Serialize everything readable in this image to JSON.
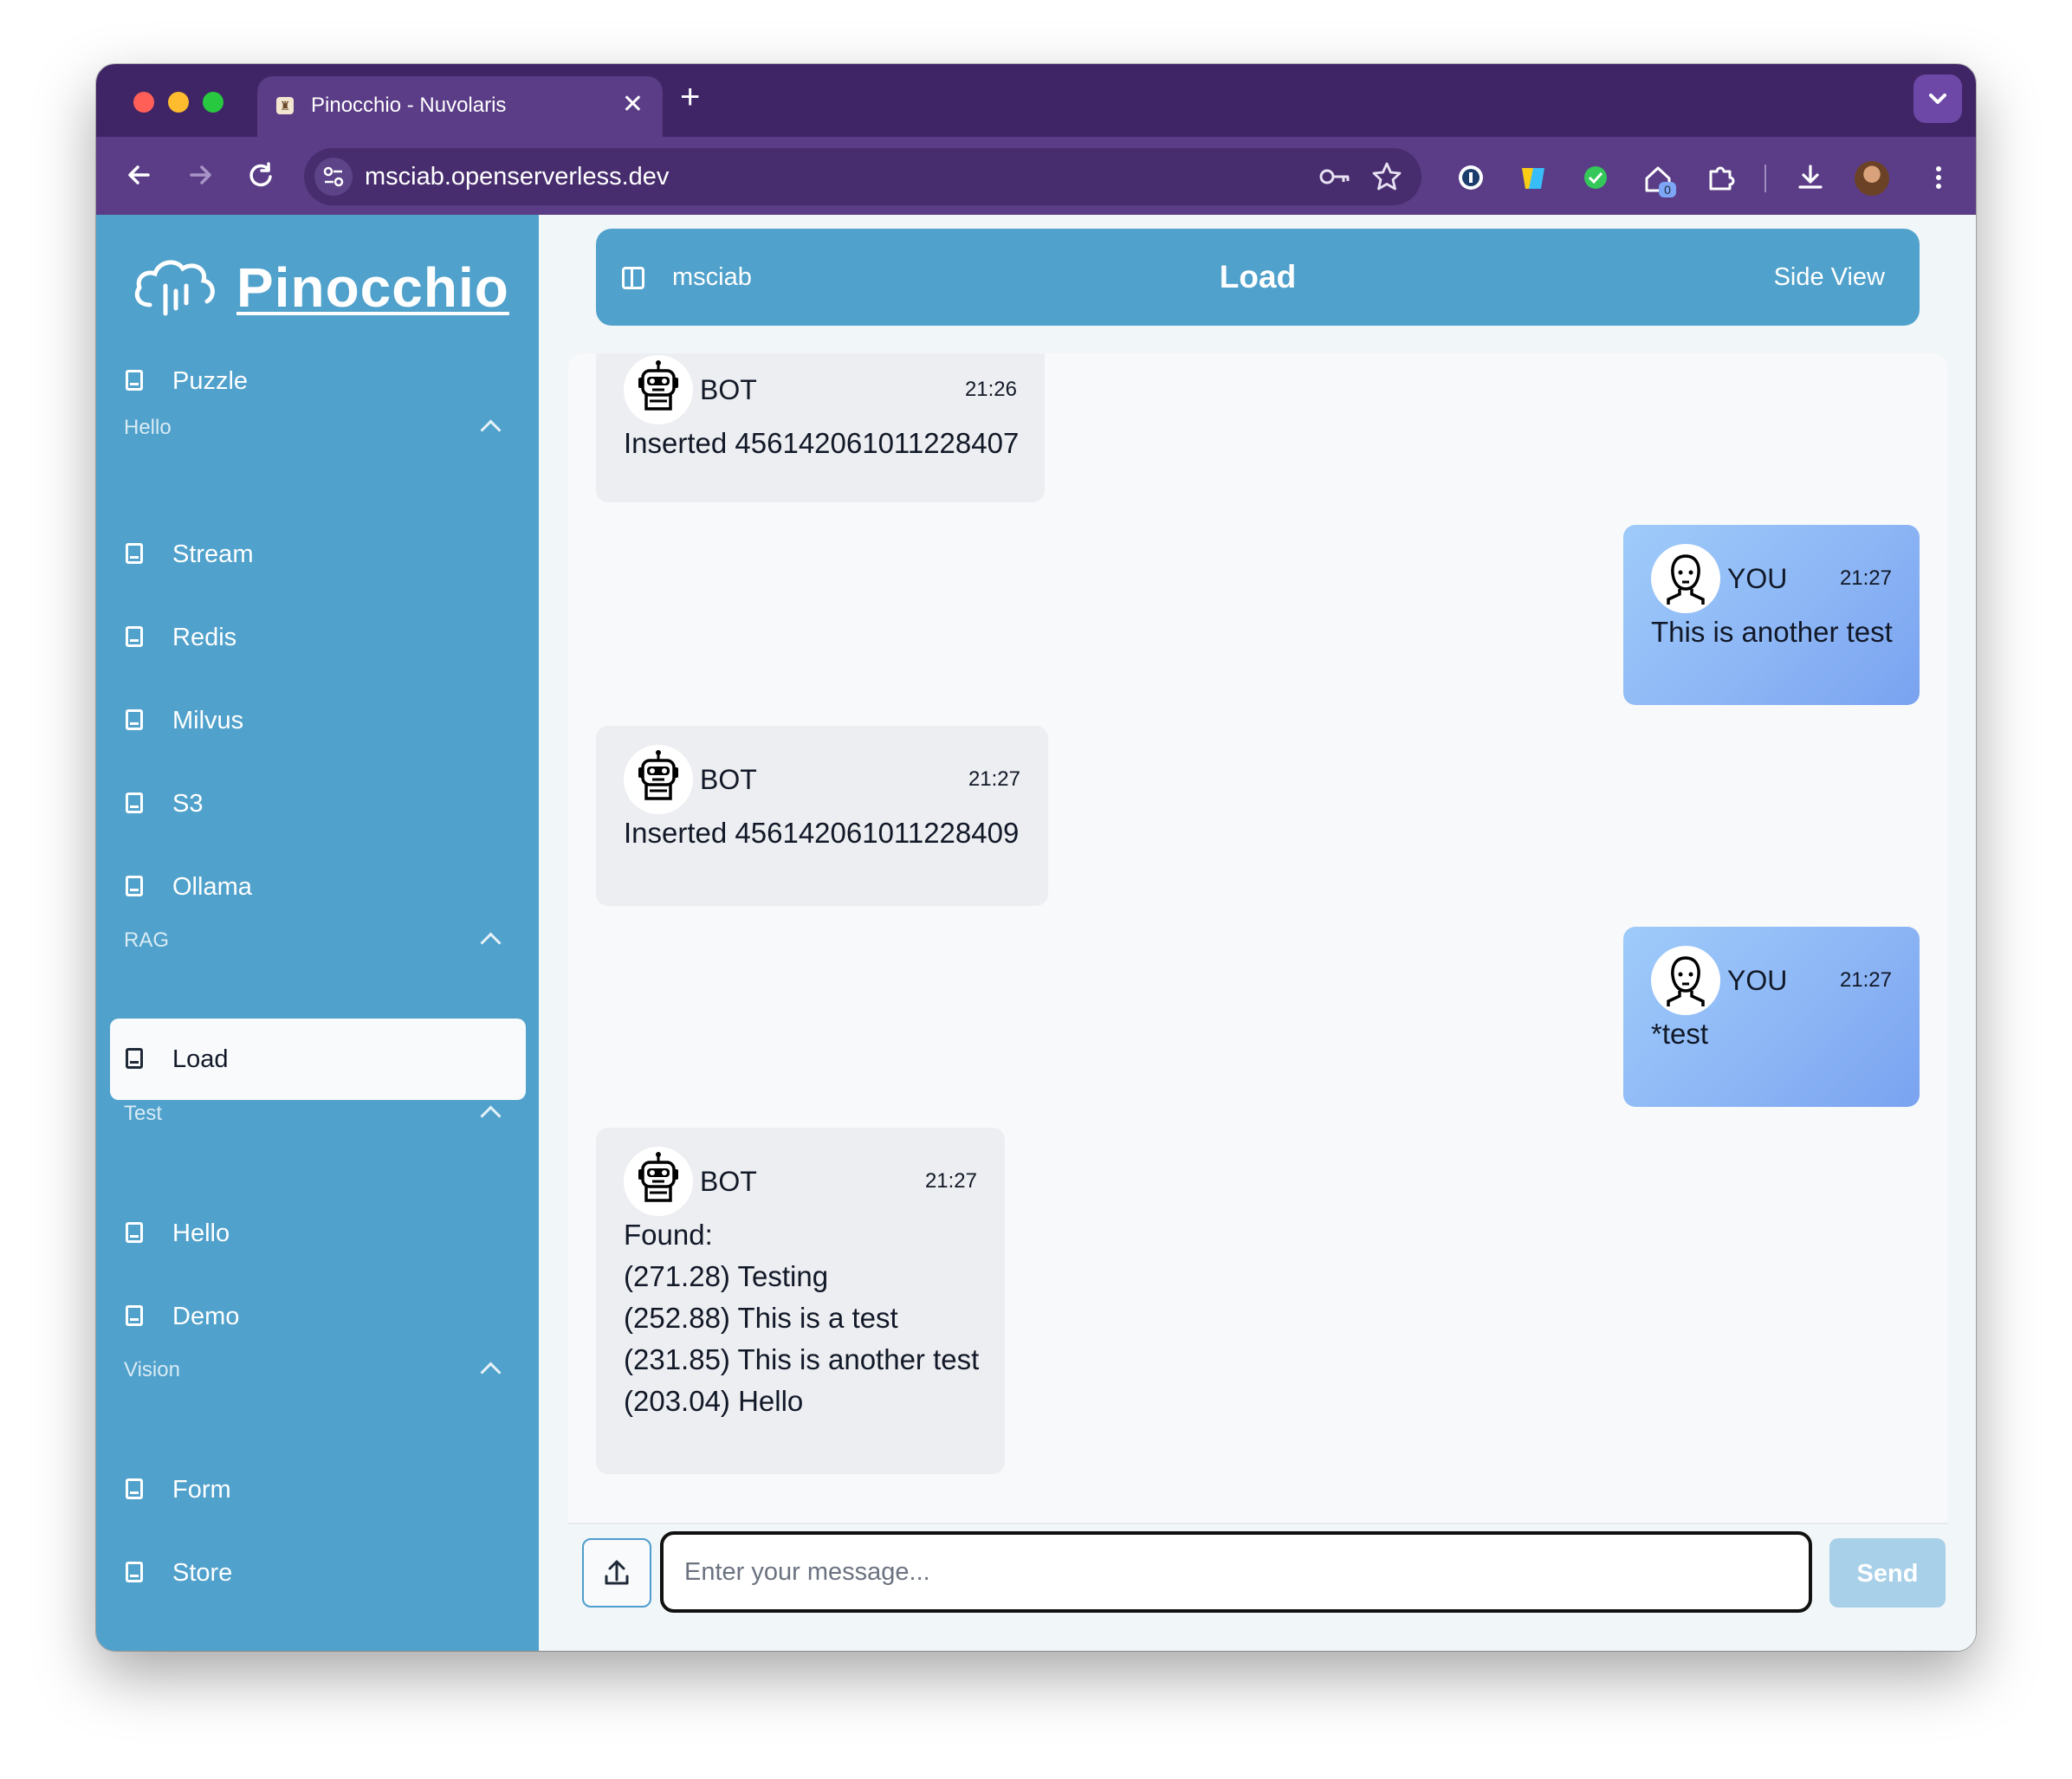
{
  "browser": {
    "tab_title": "Pinocchio - Nuvolaris",
    "tab_close": "✕",
    "new_tab": "+",
    "url": "msciab.openserverless.dev",
    "extension_badge": "0"
  },
  "sidebar": {
    "logo_text": "Pinocchio",
    "items": [
      {
        "label": "Puzzle"
      },
      {
        "section": "Hello"
      },
      {
        "label": "Stream"
      },
      {
        "label": "Redis"
      },
      {
        "label": "Milvus"
      },
      {
        "label": "S3"
      },
      {
        "label": "Ollama"
      },
      {
        "section": "RAG"
      },
      {
        "label": "Load",
        "active": true
      },
      {
        "section": "Test"
      },
      {
        "label": "Hello"
      },
      {
        "label": "Demo"
      },
      {
        "section": "Vision"
      },
      {
        "label": "Form"
      },
      {
        "label": "Store"
      }
    ]
  },
  "header": {
    "user": "msciab",
    "title": "Load",
    "side_view": "Side View"
  },
  "messages": [
    {
      "sender": "BOT",
      "time": "21:26",
      "lines": [
        "Inserted 456142061011228407"
      ]
    },
    {
      "sender": "YOU",
      "time": "21:27",
      "lines": [
        "This is another test"
      ]
    },
    {
      "sender": "BOT",
      "time": "21:27",
      "lines": [
        "Inserted 456142061011228409"
      ]
    },
    {
      "sender": "YOU",
      "time": "21:27",
      "lines": [
        "*test"
      ]
    },
    {
      "sender": "BOT",
      "time": "21:27",
      "lines": [
        "Found:",
        "(271.28) Testing",
        "(252.88) This is a test",
        "(231.85) This is another test",
        "(203.04) Hello"
      ]
    }
  ],
  "composer": {
    "placeholder": "Enter your message...",
    "send_label": "Send"
  }
}
